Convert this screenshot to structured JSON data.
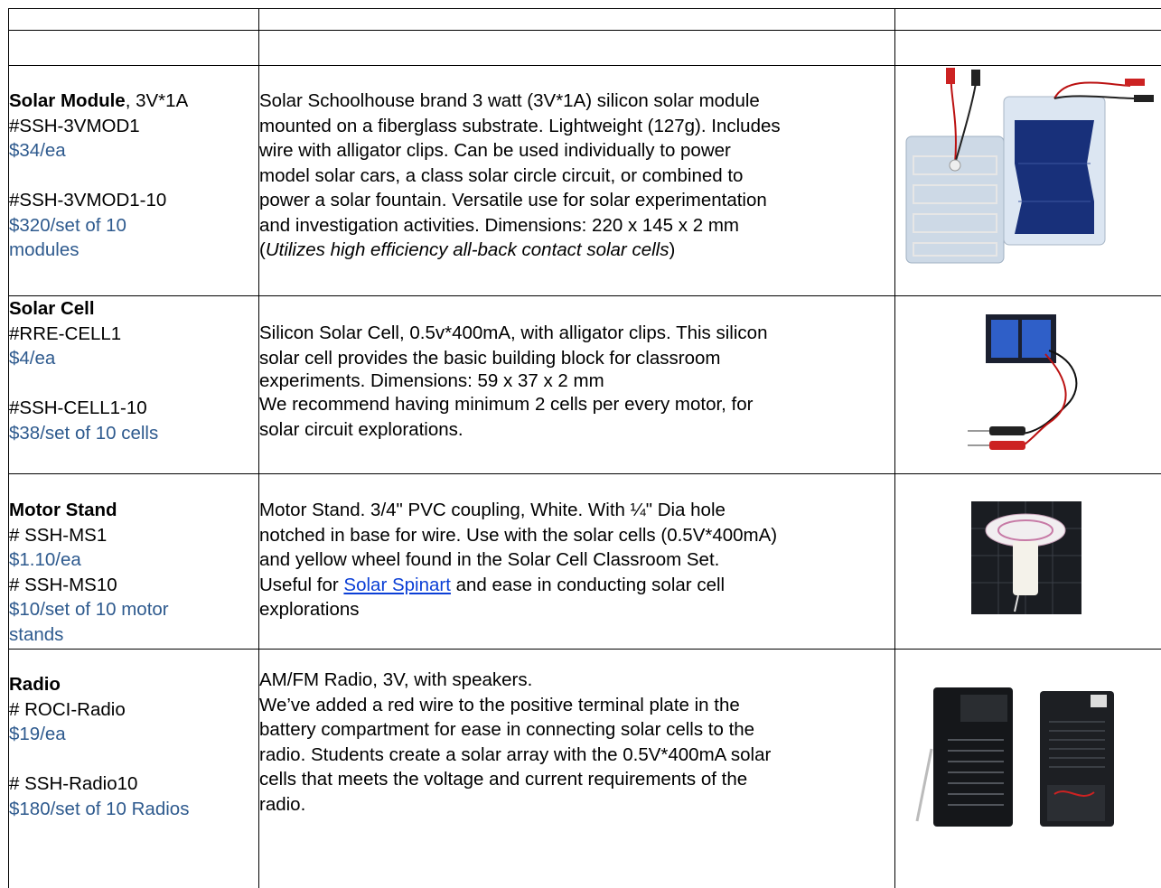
{
  "products": [
    {
      "name": "Solar Module",
      "name_suffix": ", 3V*1A",
      "sku1": "#SSH-3VMOD1",
      "price1": "$34/ea",
      "sku2": "#SSH-3VMOD1-10",
      "price2_line1": "$320/set of 10",
      "price2_line2": "modules",
      "desc_lines": [
        "Solar Schoolhouse brand 3 watt (3V*1A) silicon solar module",
        "mounted on a fiberglass substrate. Lightweight (127g). Includes",
        "wire with alligator clips. Can be used individually to power",
        "model solar cars, a class solar circle circuit, or combined to",
        "power a solar fountain. Versatile use for solar experimentation",
        "and investigation activities. Dimensions: 220 x 145 x 2 mm"
      ],
      "desc_italic_open": "(",
      "desc_italic": "Utilizes high efficiency all-back contact solar cells",
      "desc_italic_close": ")",
      "image_icon": "solar-module-photo"
    },
    {
      "name": "Solar Cell",
      "sku1": "#RRE-CELL1",
      "price1": "$4/ea",
      "sku2": "#SSH-CELL1-10",
      "price2": "$38/set of 10 cells",
      "desc_lines": [
        "Silicon Solar Cell, 0.5v*400mA, with alligator clips. This silicon",
        "solar cell provides the basic building block for classroom",
        "experiments.  Dimensions: 59 x 37 x 2 mm",
        "We recommend having minimum 2 cells per every motor, for",
        "solar circuit explorations."
      ],
      "image_icon": "solar-cell-photo"
    },
    {
      "name": "Motor Stand",
      "sku1": "# SSH-MS1",
      "price1": "$1.10/ea",
      "sku2": "# SSH-MS10",
      "price2_line1": "$10/set of 10 motor",
      "price2_line2": "stands",
      "desc_lines": [
        "Motor Stand. 3/4\" PVC coupling, White. With ¼\" Dia hole",
        "notched in base for wire. Use with the solar cells (0.5V*400mA)",
        "and yellow wheel found in the Solar Cell Classroom Set."
      ],
      "desc_link_prefix": "Useful for ",
      "desc_link": "Solar Spinart",
      "desc_link_suffix": " and ease in conducting solar cell",
      "desc_last": "explorations",
      "image_icon": "motor-stand-photo"
    },
    {
      "name": "Radio",
      "sku1": "# ROCI-Radio",
      "price1": "$19/ea",
      "sku2": "# SSH-Radio10",
      "price2": "$180/set of 10 Radios",
      "desc_lines": [
        "AM/FM Radio, 3V, with speakers.",
        "We’ve added a red wire to the positive terminal plate in the",
        "battery compartment for ease in connecting solar cells to the",
        "radio.  Students create a solar array with the 0.5V*400mA solar",
        "cells that meets the voltage and current requirements of the",
        "radio."
      ],
      "image_icon": "radio-photo"
    }
  ],
  "colors": {
    "price": "#2e5a8e",
    "link": "#0b3fd6"
  }
}
